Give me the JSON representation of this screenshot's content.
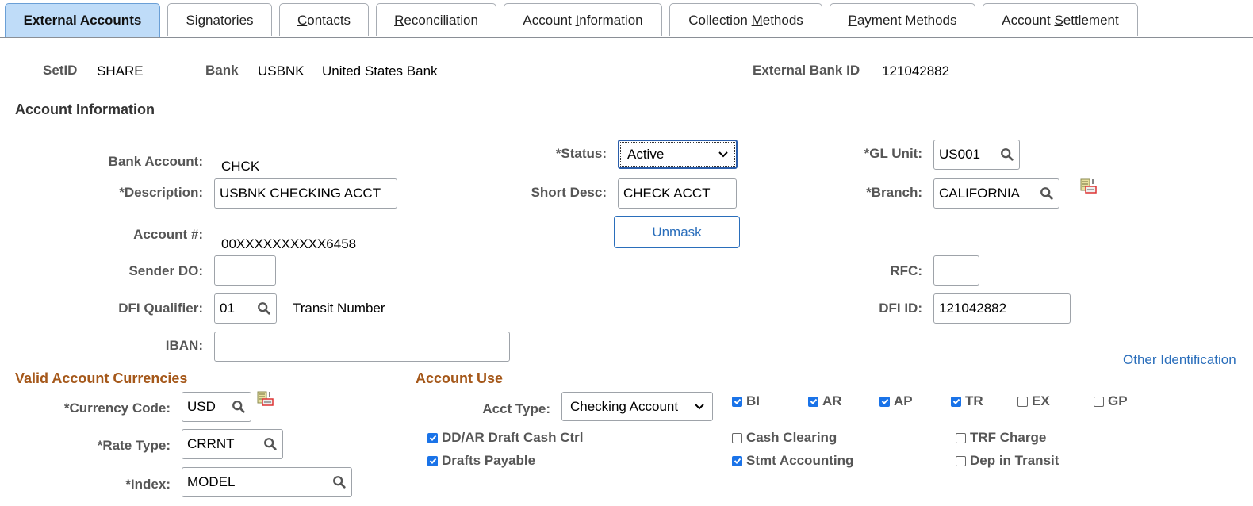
{
  "tabs": [
    {
      "label": "External Accounts",
      "active": true
    },
    {
      "label": "Signatories",
      "active": false
    },
    {
      "label": "Contacts",
      "active": false,
      "accesskey_index": 0
    },
    {
      "label": "Reconciliation",
      "active": false,
      "accesskey_index": 0
    },
    {
      "label": "Account Information",
      "active": false,
      "accesskey_index": 8
    },
    {
      "label": "Collection Methods",
      "active": false,
      "accesskey_index": 11
    },
    {
      "label": "Payment Methods",
      "active": false,
      "accesskey_index": 0
    },
    {
      "label": "Account Settlement",
      "active": false,
      "accesskey_index": 8
    }
  ],
  "header": {
    "setid_label": "SetID",
    "setid_value": "SHARE",
    "bank_label": "Bank",
    "bank_code": "USBNK",
    "bank_name": "United States Bank",
    "ext_bank_id_label": "External Bank ID",
    "ext_bank_id_value": "121042882"
  },
  "account_info": {
    "title": "Account Information",
    "bank_account_label": "Bank Account:",
    "bank_account_value": "CHCK",
    "description_label": "*Description:",
    "description_value": "USBNK CHECKING ACCT",
    "account_num_label": "Account #:",
    "account_num_value": "00XXXXXXXXXX6458",
    "sender_do_label": "Sender DO:",
    "sender_do_value": "",
    "dfi_qualifier_label": "DFI Qualifier:",
    "dfi_qualifier_value": "01",
    "dfi_qualifier_desc": "Transit Number",
    "iban_label": "IBAN:",
    "iban_value": "",
    "status_label": "*Status:",
    "status_value": "Active",
    "short_desc_label": "Short Desc:",
    "short_desc_value": "CHECK ACCT",
    "unmask_button": "Unmask",
    "gl_unit_label": "*GL Unit:",
    "gl_unit_value": "US001",
    "branch_label": "*Branch:",
    "branch_value": "CALIFORNIA",
    "rfc_label": "RFC:",
    "rfc_value": "",
    "dfi_id_label": "DFI ID:",
    "dfi_id_value": "121042882",
    "other_identification_link": "Other Identification"
  },
  "currencies": {
    "title": "Valid Account Currencies",
    "currency_code_label": "*Currency Code:",
    "currency_code_value": "USD",
    "rate_type_label": "*Rate Type:",
    "rate_type_value": "CRRNT",
    "index_label": "*Index:",
    "index_value": "MODEL"
  },
  "account_use": {
    "title": "Account Use",
    "acct_type_label": "Acct Type:",
    "acct_type_value": "Checking Account",
    "top_checks": [
      {
        "label": "BI",
        "checked": true
      },
      {
        "label": "AR",
        "checked": true
      },
      {
        "label": "AP",
        "checked": true
      },
      {
        "label": "TR",
        "checked": true
      },
      {
        "label": "EX",
        "checked": false
      },
      {
        "label": "GP",
        "checked": false
      }
    ],
    "checks": [
      {
        "label": "DD/AR Draft Cash Ctrl",
        "checked": true
      },
      {
        "label": "Drafts Payable",
        "checked": true
      },
      {
        "label": "Cash Clearing",
        "checked": false
      },
      {
        "label": "Stmt Accounting",
        "checked": true
      },
      {
        "label": "TRF Charge",
        "checked": false
      },
      {
        "label": "Dep in Transit",
        "checked": false
      }
    ]
  },
  "colors": {
    "accent": "#2a6ebb",
    "active_tab": "#bfdcf8",
    "section_orange": "#a5581a",
    "checkbox_on": "#1a73e8"
  }
}
